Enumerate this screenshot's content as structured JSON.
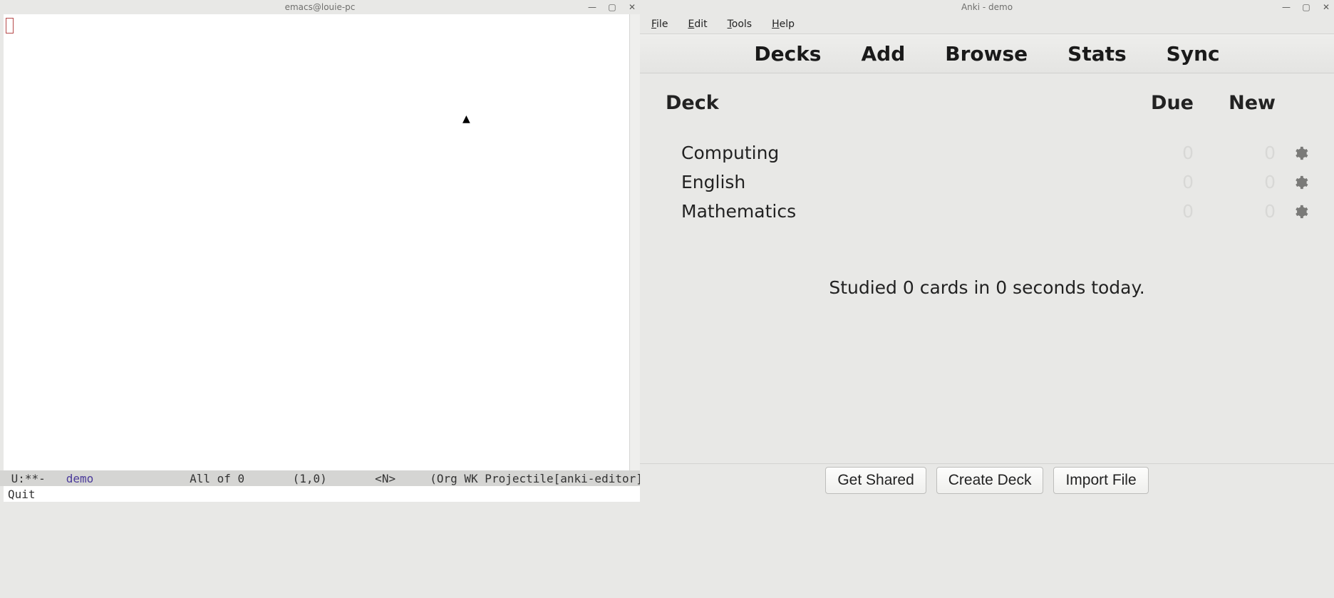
{
  "emacs": {
    "title": "emacs@louie-pc",
    "modeline": {
      "prefix": " U:**-   ",
      "buffer": "demo",
      "after_buffer": "              All of 0       (1,0)       <N>     (Org WK Projectile[anki-editor]"
    },
    "echo": "Quit"
  },
  "anki": {
    "title": "Anki - demo",
    "menubar": [
      "File",
      "Edit",
      "Tools",
      "Help"
    ],
    "toolbar": [
      "Decks",
      "Add",
      "Browse",
      "Stats",
      "Sync"
    ],
    "columns": {
      "deck": "Deck",
      "due": "Due",
      "new": "New"
    },
    "decks": [
      {
        "name": "Computing",
        "due": "0",
        "new": "0"
      },
      {
        "name": "English",
        "due": "0",
        "new": "0"
      },
      {
        "name": "Mathematics",
        "due": "0",
        "new": "0"
      }
    ],
    "summary": "Studied 0 cards in 0 seconds today.",
    "buttons": {
      "shared": "Get Shared",
      "create": "Create Deck",
      "import": "Import File"
    }
  }
}
